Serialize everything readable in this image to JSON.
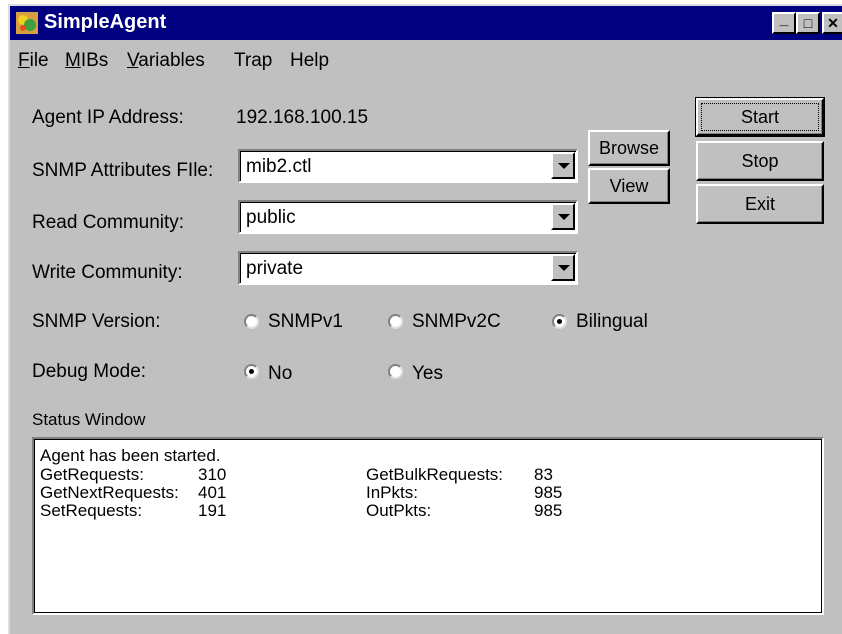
{
  "window": {
    "title": "SimpleAgent",
    "controls": {
      "minimize": "_",
      "maximize": "□",
      "close": "✕"
    }
  },
  "menu": [
    {
      "label": "File",
      "accel": "F",
      "rest": "ile"
    },
    {
      "label": "MIBs",
      "accel": "M",
      "rest": "IBs"
    },
    {
      "label": "Variables",
      "accel": "V",
      "rest": "ariables"
    },
    {
      "label": "Trap"
    },
    {
      "label": "Help"
    }
  ],
  "form": {
    "agent_ip_label": "Agent IP Address:",
    "agent_ip_value": "192.168.100.15",
    "snmp_attr_label": "SNMP Attributes FIle:",
    "snmp_attr_value": "mib2.ctl",
    "read_community_label": "Read Community:",
    "read_community_value": "public",
    "write_community_label": "Write Community:",
    "write_community_value": "private",
    "snmp_version_label": "SNMP Version:",
    "snmp_version_options": [
      "SNMPv1",
      "SNMPv2C",
      "Bilingual"
    ],
    "snmp_version_selected": "Bilingual",
    "debug_mode_label": "Debug Mode:",
    "debug_mode_options": [
      "No",
      "Yes"
    ],
    "debug_mode_selected": "No"
  },
  "buttons": {
    "browse": "Browse",
    "view": "View",
    "start": "Start",
    "stop": "Stop",
    "exit": "Exit"
  },
  "status": {
    "label": "Status Window",
    "first_line": "Agent has been started.",
    "rows": [
      {
        "label": "GetRequests:",
        "value": "310",
        "label2": "GetBulkRequests:",
        "value2": "83"
      },
      {
        "label": "GetNextRequests:",
        "value": "401",
        "label2": "InPkts:",
        "value2": "985"
      },
      {
        "label": "SetRequests:",
        "value": "191",
        "label2": "OutPkts:",
        "value2": "985"
      }
    ]
  },
  "colors": {
    "title_bar": "#000080",
    "face": "#c0c0c0"
  }
}
